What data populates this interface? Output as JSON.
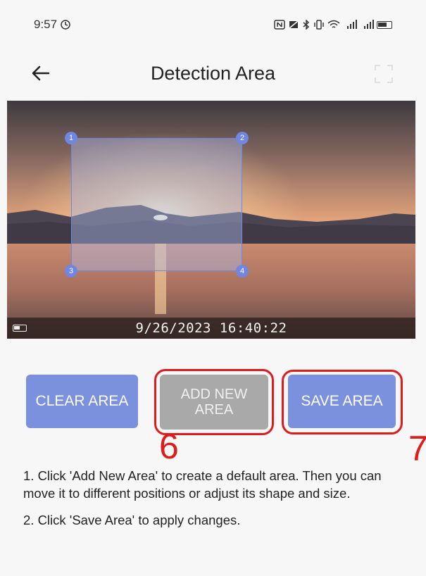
{
  "status_bar": {
    "time": "9:57",
    "icons": [
      "nfc-icon",
      "mute-icon",
      "bluetooth-icon",
      "vibrate-icon",
      "wifi-icon",
      "signal-4g-icon",
      "signal-5g-icon",
      "battery-icon"
    ]
  },
  "app_bar": {
    "title": "Detection Area",
    "back_icon": "arrow-left-icon",
    "fullscreen_icon": "fullscreen-icon"
  },
  "camera": {
    "timestamp": "9/26/2023 16:40:22",
    "area_handles": [
      "1",
      "2",
      "3",
      "4"
    ]
  },
  "buttons": {
    "clear_label": "CLEAR AREA",
    "add_label": "ADD NEW AREA",
    "save_label": "SAVE AREA"
  },
  "annotations": {
    "add_marker": "6",
    "save_marker": "7"
  },
  "instructions": [
    "1. Click 'Add New Area' to create a default area. Then you can move it to different positions or adjust its shape and size.",
    "2. Click 'Save Area' to apply changes."
  ],
  "colors": {
    "accent": "#7b91de",
    "area_stroke": "#6f86e3",
    "disabled": "#a9a9a9",
    "highlight": "#e11b1b"
  }
}
